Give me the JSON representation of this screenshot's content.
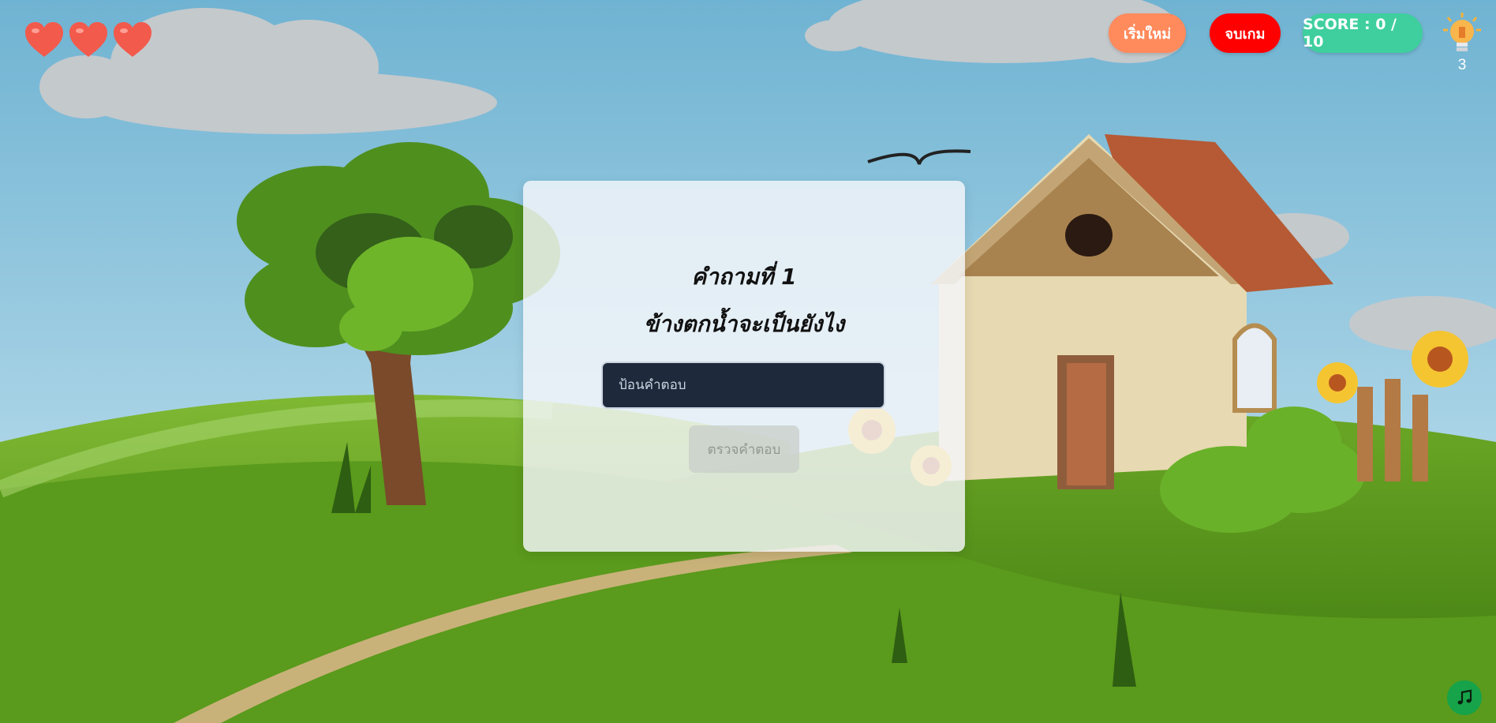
{
  "hud": {
    "lives": 3,
    "restart_label": "เริ่มใหม่",
    "end_label": "จบเกม",
    "score_label": "SCORE : 0 / 10",
    "hint_count": "3"
  },
  "quiz": {
    "title": "คำถามที่ 1",
    "question": "ข้างตกน้ำจะเป็นยังไง",
    "answer_placeholder": "ป้อนคำตอบ",
    "check_label": "ตรวจคำตอบ"
  },
  "icons": {
    "heart": "heart-icon",
    "hint": "lightbulb-icon",
    "music": "music-note-icon"
  },
  "colors": {
    "restart": "#ff8a5c",
    "end": "#ff0000",
    "score": "#3fcf9e",
    "music": "#16a34a"
  }
}
